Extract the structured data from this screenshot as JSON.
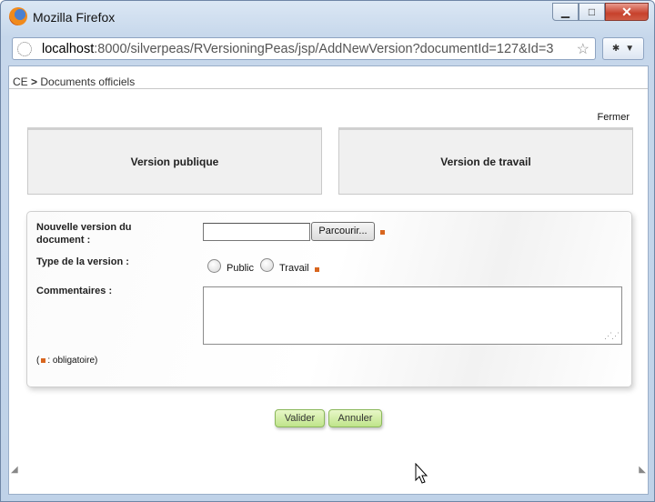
{
  "window": {
    "title": "Mozilla Firefox",
    "minimize": "▁",
    "maximize": "□",
    "close": "✕"
  },
  "urlbar": {
    "host": "localhost",
    "rest": ":8000/silverpeas/RVersioningPeas/jsp/AddNewVersion?documentId=127&Id=3",
    "star": "☆"
  },
  "breadcrumb": {
    "root": "CE",
    "separator": ">",
    "current": "Documents officiels"
  },
  "close_link": "Fermer",
  "tabs": {
    "public": "Version publique",
    "work": "Version de travail"
  },
  "form": {
    "new_version_label_1": "Nouvelle version du",
    "new_version_label_2": "document :",
    "browse_button": "Parcourir...",
    "file_value": "",
    "version_type_label": "Type de la version :",
    "radio_public": "Public",
    "radio_work": "Travail",
    "comments_label": "Commentaires :",
    "comments_value": "",
    "legend_prefix": "(",
    "legend_suffix": ": obligatoire)"
  },
  "buttons": {
    "validate": "Valider",
    "cancel": "Annuler"
  },
  "colors": {
    "required_marker": "#d8661f",
    "button_green": "#bfe48a"
  }
}
